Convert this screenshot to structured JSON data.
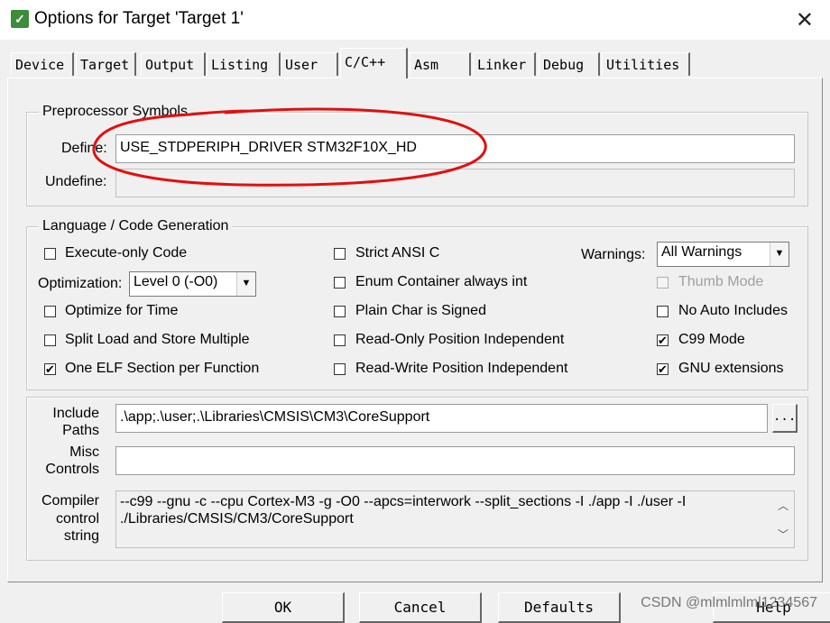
{
  "window": {
    "title": "Options for Target 'Target 1'",
    "close_glyph": "✕",
    "app_icon_glyph": "✓"
  },
  "tabs": [
    "Device",
    "Target",
    "Output",
    "Listing",
    "User",
    "C/C++",
    "Asm",
    "Linker",
    "Debug",
    "Utilities"
  ],
  "active_tab": "C/C++",
  "preprocessor": {
    "group_title": "Preprocessor Symbols",
    "define_label": "Define:",
    "define_value": "USE_STDPERIPH_DRIVER STM32F10X_HD",
    "undefine_label": "Undefine:",
    "undefine_value": ""
  },
  "language": {
    "group_title": "Language / Code Generation",
    "execute_only": {
      "label": "Execute-only Code",
      "checked": false
    },
    "optimization_label": "Optimization:",
    "optimization_value": "Level 0 (-O0)",
    "optimize_time": {
      "label": "Optimize for Time",
      "checked": false
    },
    "split_load": {
      "label": "Split Load and Store Multiple",
      "checked": false
    },
    "one_elf": {
      "label": "One ELF Section per Function",
      "checked": true
    },
    "strict_ansi": {
      "label": "Strict ANSI C",
      "checked": false
    },
    "enum_container": {
      "label": "Enum Container always int",
      "checked": false
    },
    "plain_char": {
      "label": "Plain Char is Signed",
      "checked": false
    },
    "ro_pos": {
      "label": "Read-Only Position Independent",
      "checked": false
    },
    "rw_pos": {
      "label": "Read-Write Position Independent",
      "checked": false
    },
    "warnings_label": "Warnings:",
    "warnings_value": "All Warnings",
    "thumb_mode": {
      "label": "Thumb Mode",
      "checked": false
    },
    "no_auto_includes": {
      "label": "No Auto Includes",
      "checked": false
    },
    "c99_mode": {
      "label": "C99 Mode",
      "checked": true
    },
    "gnu_ext": {
      "label": "GNU extensions",
      "checked": true
    }
  },
  "include": {
    "label_line1": "Include",
    "label_line2": "Paths",
    "value": ".\\app;.\\user;.\\Libraries\\CMSIS\\CM3\\CoreSupport",
    "browse": "..."
  },
  "misc": {
    "label_line1": "Misc",
    "label_line2": "Controls",
    "value": ""
  },
  "compiler": {
    "label_line1": "Compiler",
    "label_line2": "control",
    "label_line3": "string",
    "line1": "--c99 --gnu -c --cpu Cortex-M3 -g -O0 --apcs=interwork --split_sections -I ./app -I ./user -I",
    "line2": "./Libraries/CMSIS/CM3/CoreSupport"
  },
  "buttons": {
    "ok": "OK",
    "cancel": "Cancel",
    "defaults": "Defaults",
    "help": "Help"
  },
  "watermark": "CSDN @mlmlmlml1234567",
  "colors": {
    "annotation_red": "#e01010"
  }
}
